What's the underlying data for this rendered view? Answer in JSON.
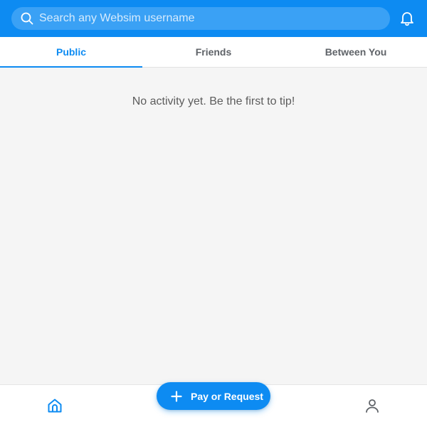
{
  "header": {
    "search": {
      "placeholder": "Search any Websim username",
      "value": ""
    },
    "notification_icon": "bell-icon"
  },
  "tabs": [
    {
      "label": "Public",
      "active": true
    },
    {
      "label": "Friends",
      "active": false
    },
    {
      "label": "Between You",
      "active": false
    }
  ],
  "feed": {
    "empty_message": "No activity yet. Be the first to tip!"
  },
  "fab": {
    "icon": "plus-icon",
    "label": "Pay or Request"
  },
  "bottom_nav": {
    "home_icon": "home-icon",
    "profile_icon": "user-icon"
  },
  "colors": {
    "brand_blue": "#0d8bf2",
    "search_bg": "#3aa1f5",
    "background": "#f5f5f5",
    "tab_inactive": "#5f6368"
  }
}
